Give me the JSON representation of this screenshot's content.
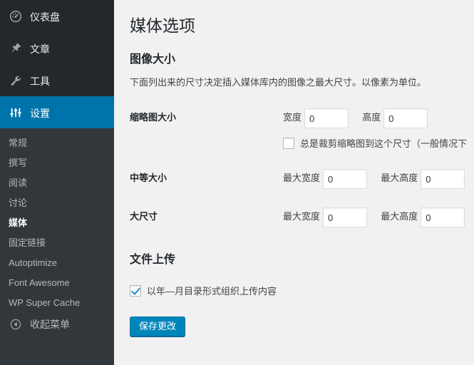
{
  "sidebar": {
    "top_items": [
      {
        "label": "仪表盘",
        "icon": "dashboard-gauge-icon",
        "current": false
      },
      {
        "label": "文章",
        "icon": "pushpin-icon",
        "current": false
      },
      {
        "label": "工具",
        "icon": "wrench-icon",
        "current": false
      },
      {
        "label": "设置",
        "icon": "sliders-icon",
        "current": true
      }
    ],
    "submenu": [
      {
        "label": "常规",
        "current": false
      },
      {
        "label": "撰写",
        "current": false
      },
      {
        "label": "阅读",
        "current": false
      },
      {
        "label": "讨论",
        "current": false
      },
      {
        "label": "媒体",
        "current": true
      },
      {
        "label": "固定链接",
        "current": false
      },
      {
        "label": "Autoptimize",
        "current": false
      },
      {
        "label": "Font Awesome",
        "current": false
      },
      {
        "label": "WP Super Cache",
        "current": false
      }
    ],
    "collapse": {
      "label": "收起菜单",
      "icon": "collapse-arrow-left-icon"
    },
    "colors": {
      "bg": "#23282d",
      "submenu_bg": "#32373c",
      "current": "#0073aa",
      "text": "#b4b9be"
    }
  },
  "main": {
    "page_title": "媒体选项",
    "image_sizes": {
      "heading": "图像大小",
      "description": "下面列出来的尺寸决定插入媒体库内的图像之最大尺寸。以像素为单位。",
      "rows": [
        {
          "label": "缩略图大小",
          "fields": [
            {
              "label": "宽度",
              "value": "0"
            },
            {
              "label": "高度",
              "value": "0"
            }
          ],
          "checkbox": {
            "label": "总是裁剪缩略图到这个尺寸（一般情况下",
            "checked": false
          }
        },
        {
          "label": "中等大小",
          "fields": [
            {
              "label": "最大宽度",
              "value": "0"
            },
            {
              "label": "最大高度",
              "value": "0"
            }
          ]
        },
        {
          "label": "大尺寸",
          "fields": [
            {
              "label": "最大宽度",
              "value": "0"
            },
            {
              "label": "最大高度",
              "value": "0"
            }
          ]
        }
      ]
    },
    "uploading_files": {
      "heading": "文件上传",
      "checkbox": {
        "label": "以年—月目录形式组织上传内容",
        "checked": true
      }
    },
    "submit": {
      "label": "保存更改",
      "color": "#0085ba"
    }
  }
}
